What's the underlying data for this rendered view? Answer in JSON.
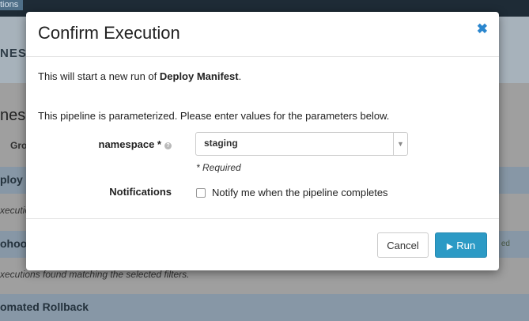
{
  "background": {
    "top_tab": "tions",
    "subheader_label": "NES",
    "app_title": "nes",
    "group_label": "Gro",
    "pipelines": [
      {
        "name": "ploy M"
      },
      {
        "name": "ohoo",
        "status": "ed"
      },
      {
        "name": "omated Rollback"
      }
    ],
    "exec_texts": [
      "xecutio",
      "xecutions found matching the selected filters."
    ]
  },
  "modal": {
    "title": "Confirm Execution",
    "close_icon": "times-icon",
    "intro_prefix": "This will start a new run of ",
    "pipeline_name": "Deploy Manifest",
    "intro_suffix": ".",
    "param_note": "This pipeline is parameterized. Please enter values for the parameters below.",
    "fields": {
      "namespace": {
        "label": "namespace *",
        "value": "staging",
        "required_text": "* Required",
        "help_icon": "question-circle-icon"
      },
      "notifications": {
        "label": "Notifications",
        "checkbox_label": "Notify me when the pipeline completes",
        "checked": false
      }
    },
    "buttons": {
      "cancel": "Cancel",
      "run": "Run"
    }
  },
  "colors": {
    "accent": "#2c9ac5",
    "close": "#2a86ce"
  }
}
